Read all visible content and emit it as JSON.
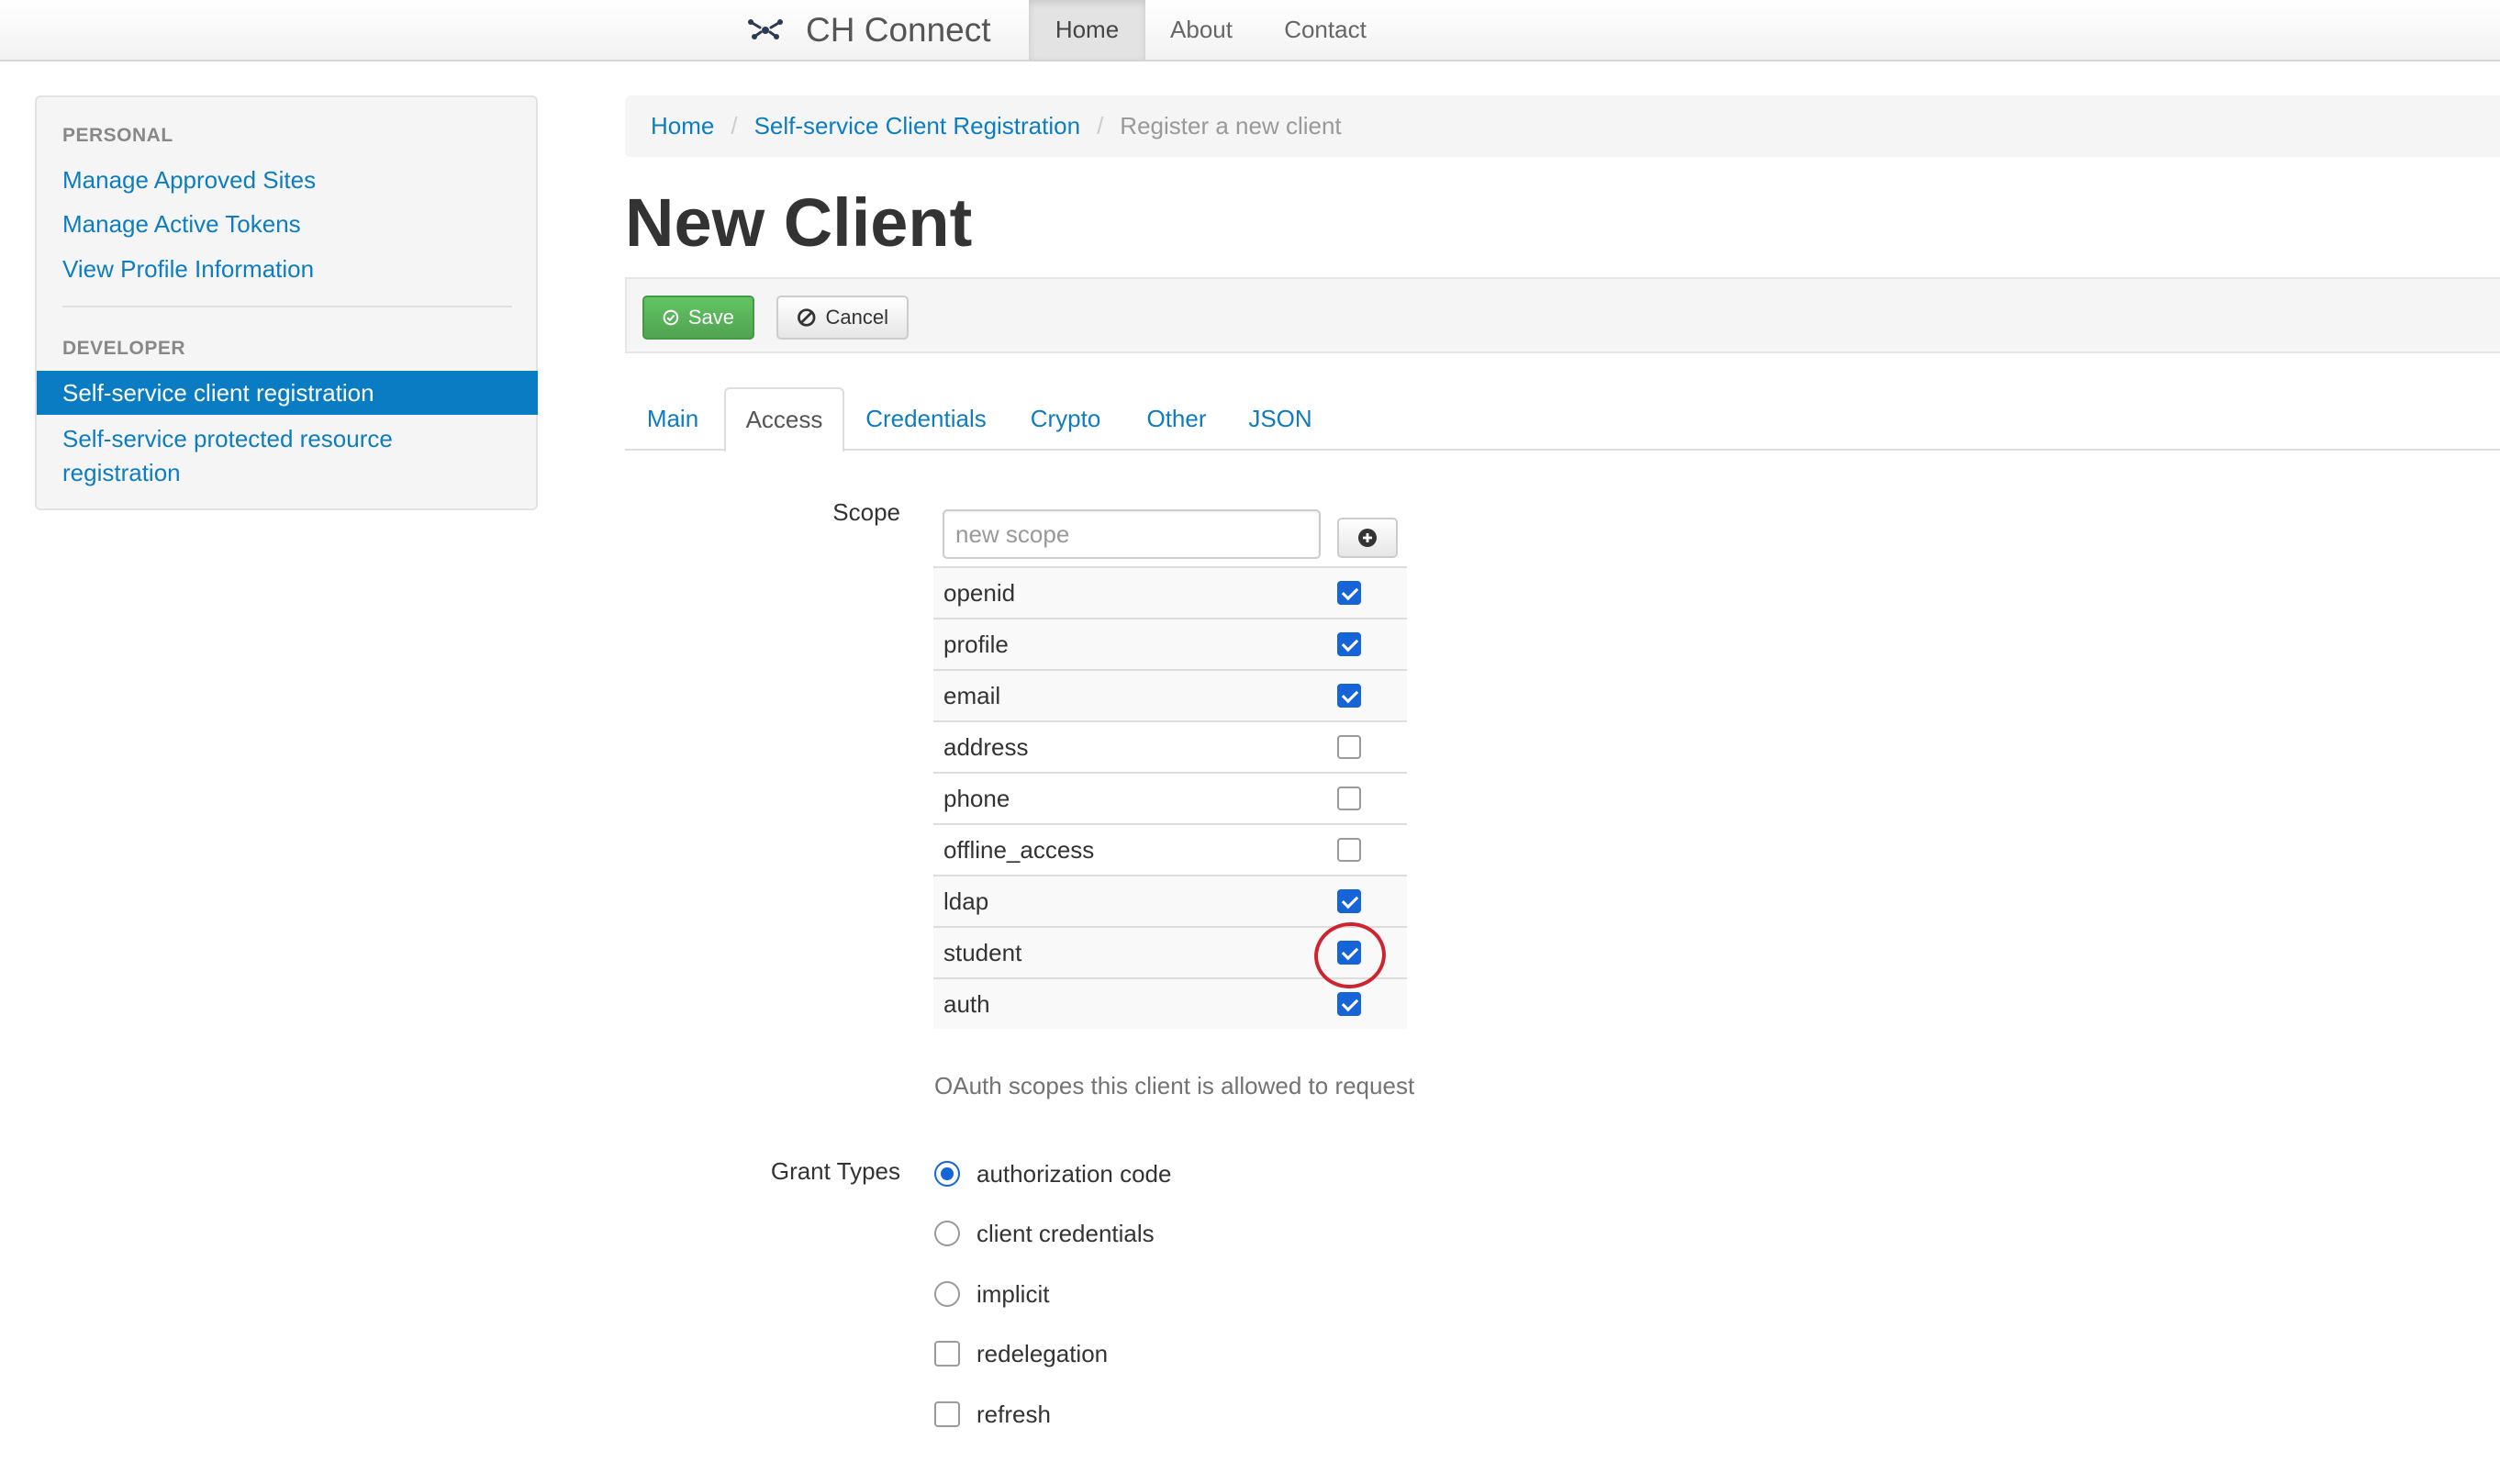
{
  "navbar": {
    "brand": "CH Connect",
    "items": [
      {
        "label": "Home",
        "active": true
      },
      {
        "label": "About",
        "active": false
      },
      {
        "label": "Contact",
        "active": false
      }
    ]
  },
  "sidebar": {
    "personal_header": "PERSONAL",
    "personal_links": [
      "Manage Approved Sites",
      "Manage Active Tokens",
      "View Profile Information"
    ],
    "developer_header": "DEVELOPER",
    "developer_links": [
      {
        "label": "Self-service client registration",
        "active": true
      },
      {
        "label_line1": "Self-service protected resource",
        "label_line2": "registration",
        "active": false
      }
    ]
  },
  "breadcrumb": {
    "home": "Home",
    "section": "Self-service Client Registration",
    "current": "Register a new client",
    "separator": "/"
  },
  "page_title": "New Client",
  "toolbar": {
    "save_label": "Save",
    "cancel_label": "Cancel"
  },
  "tabs": [
    {
      "label": "Main",
      "active": false
    },
    {
      "label": "Access",
      "active": true
    },
    {
      "label": "Credentials",
      "active": false
    },
    {
      "label": "Crypto",
      "active": false
    },
    {
      "label": "Other",
      "active": false
    },
    {
      "label": "JSON",
      "active": false
    }
  ],
  "scope": {
    "label": "Scope",
    "placeholder": "new scope",
    "items": [
      {
        "name": "openid",
        "checked": true
      },
      {
        "name": "profile",
        "checked": true
      },
      {
        "name": "email",
        "checked": true
      },
      {
        "name": "address",
        "checked": false
      },
      {
        "name": "phone",
        "checked": false
      },
      {
        "name": "offline_access",
        "checked": false
      },
      {
        "name": "ldap",
        "checked": true
      },
      {
        "name": "student",
        "checked": true,
        "highlighted": true
      },
      {
        "name": "auth",
        "checked": true
      }
    ],
    "help": "OAuth scopes this client is allowed to request"
  },
  "grant_types": {
    "label": "Grant Types",
    "options": [
      {
        "label": "authorization code",
        "type": "radio",
        "checked": true
      },
      {
        "label": "client credentials",
        "type": "radio",
        "checked": false
      },
      {
        "label": "implicit",
        "type": "radio",
        "checked": false
      },
      {
        "label": "redelegation",
        "type": "checkbox",
        "checked": false
      },
      {
        "label": "refresh",
        "type": "checkbox",
        "checked": false
      }
    ]
  },
  "colors": {
    "link": "#0d7dc1",
    "active_nav": "#0a7cc4",
    "save": "#51a351",
    "checkbox": "#1565d8",
    "annotation": "#d0232e"
  }
}
